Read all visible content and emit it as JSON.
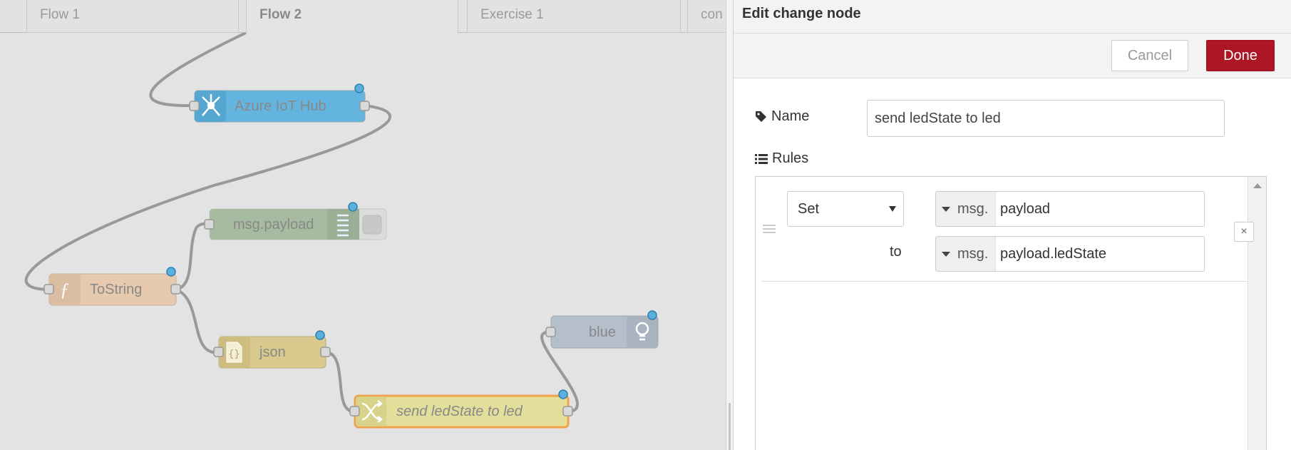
{
  "tabs": [
    {
      "label": "Flow 1"
    },
    {
      "label": "Flow 2"
    },
    {
      "label": "Exercise 1"
    },
    {
      "label": "con"
    }
  ],
  "nodes": {
    "azure": {
      "label": "Azure IoT Hub",
      "color": "#63b5df"
    },
    "debug": {
      "label": "msg.payload",
      "color": "#a6bba0"
    },
    "tostring": {
      "label": "ToString",
      "color": "#e6c9ae"
    },
    "json": {
      "label": "json",
      "color": "#dac98d"
    },
    "change": {
      "label": "send ledState to led",
      "color": "#e3de9a"
    },
    "blue": {
      "label": "blue",
      "color": "#b5bfcc"
    }
  },
  "tray": {
    "title": "Edit change node",
    "cancel_label": "Cancel",
    "done_label": "Done",
    "name_label": "Name",
    "name_value": "send ledState to led",
    "rules_label": "Rules",
    "accent": "#ad1625"
  },
  "rule": {
    "action": "Set",
    "target_type": "msg.",
    "target_value": "payload",
    "to_label": "to",
    "source_type": "msg.",
    "source_value": "payload.ledState",
    "delete_icon": "×"
  },
  "icons": [
    "tag-icon",
    "list-icon",
    "azure-hub-icon",
    "function-icon",
    "json-icon",
    "change-shuffle-icon",
    "debug-list-icon",
    "lightbulb-icon",
    "caret-down-icon",
    "close-icon"
  ]
}
